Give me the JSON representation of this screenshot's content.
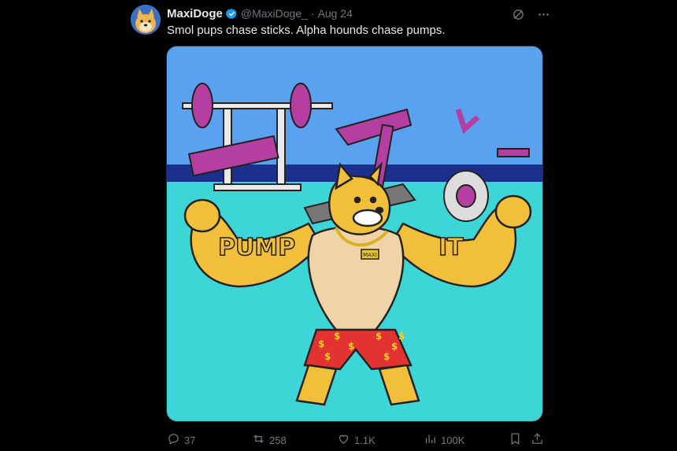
{
  "tweet": {
    "display_name": "MaxiDoge",
    "handle": "@MaxiDoge_",
    "separator": "·",
    "date": "Aug 24",
    "text": "Smol pups chase sticks. Alpha hounds chase pumps.",
    "verified": true
  },
  "media": {
    "description_icon": "cartoon-image",
    "pump_text": "PUMP",
    "it_text": "IT",
    "chain_tag": "MAXI"
  },
  "actions": {
    "replies": "37",
    "reposts": "258",
    "likes": "1.1K",
    "views": "100K"
  },
  "colors": {
    "background": "#000000",
    "text_primary": "#e7e9ea",
    "text_secondary": "#71767b",
    "verified": "#1d9bf0"
  },
  "icons": [
    "grok-icon",
    "more-icon",
    "reply-icon",
    "repost-icon",
    "like-icon",
    "views-icon",
    "bookmark-icon",
    "share-icon"
  ]
}
